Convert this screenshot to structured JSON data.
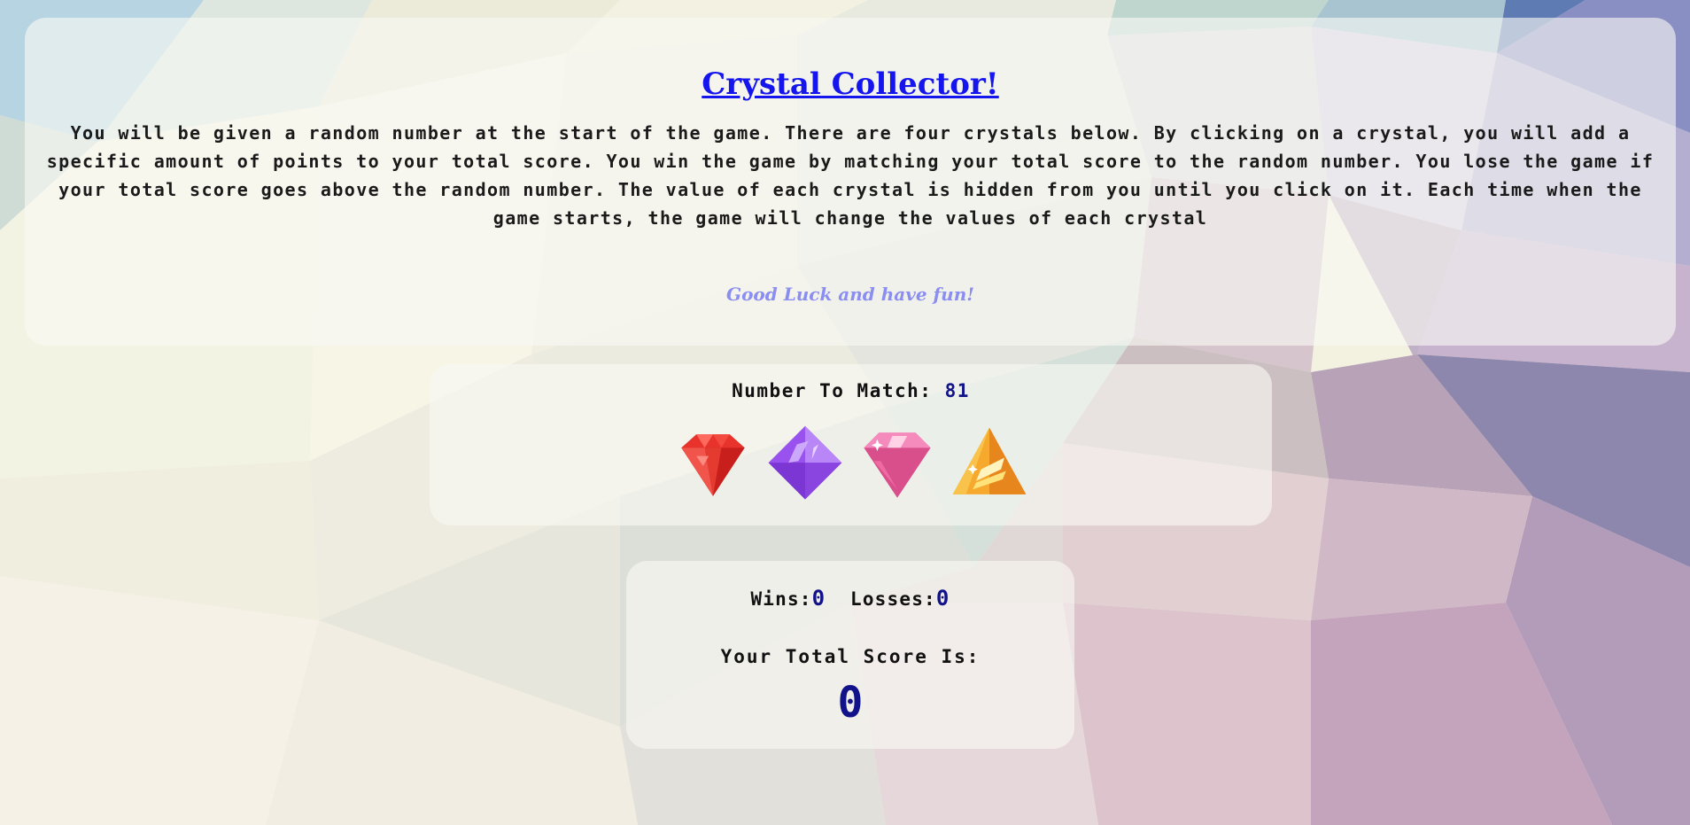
{
  "header": {
    "title": "Crystal Collector!",
    "description": "You will be given a random number at the start of the game. There are four crystals below. By clicking on a crystal, you will add a specific amount of points to your total score. You win the game by matching your total score to the random number. You lose the game if your total score goes above the random number. The value of each crystal is hidden from you until you click on it. Each time when the game starts, the game will change the values of each crystal",
    "good_luck": "Good Luck and have fun!"
  },
  "match": {
    "label": "Number To Match:",
    "value": "81"
  },
  "crystals": [
    {
      "icon": "red-crystal-icon",
      "color": "#e8332c"
    },
    {
      "icon": "purple-crystal-icon",
      "color": "#9a52ee"
    },
    {
      "icon": "pink-crystal-icon",
      "color": "#ec6fa8"
    },
    {
      "icon": "orange-crystal-icon",
      "color": "#f7a92e"
    }
  ],
  "stats": {
    "wins_label": "Wins:",
    "wins": "0",
    "losses_label": "Losses:",
    "losses": "0",
    "total_label": "Your Total Score Is:",
    "total": "0"
  },
  "colors": {
    "title": "#1515ee",
    "good_luck": "#8a8ef0",
    "number": "#12128a"
  }
}
